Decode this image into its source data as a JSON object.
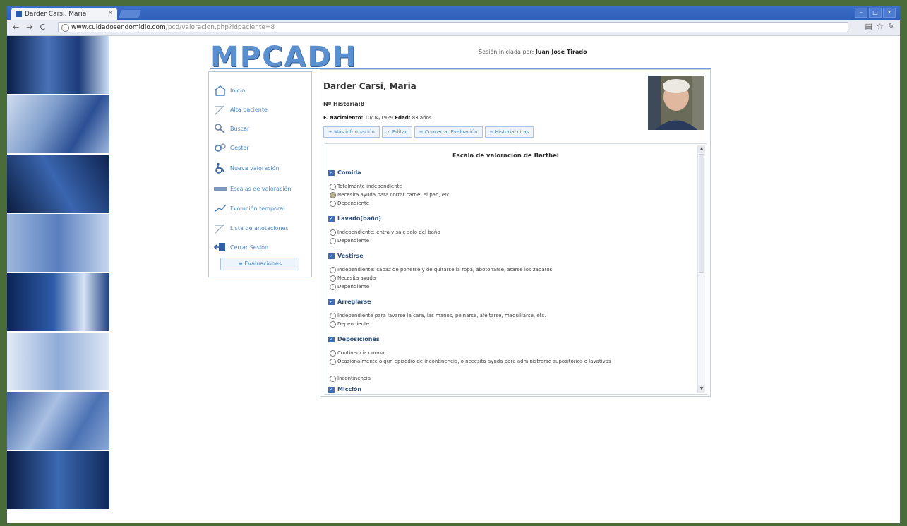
{
  "browser": {
    "tab_title": "Darder Carsi, Maria",
    "url_host": "www.cuidadosendomidio.com",
    "url_path": "/pcd/valoracion.php?idpaciente=8"
  },
  "site": {
    "logo": "MPCADH",
    "session_label": "Sesión iniciada por:",
    "session_user": "Juan José Tirado"
  },
  "menu": {
    "items": [
      {
        "label": "Inicio",
        "icon": "home-icon"
      },
      {
        "label": "Alta paciente",
        "icon": "pen-icon"
      },
      {
        "label": "Buscar",
        "icon": "magnifier-icon"
      },
      {
        "label": "Gestor",
        "icon": "gears-icon"
      },
      {
        "label": "Nueva valoración",
        "icon": "wheelchair-icon"
      },
      {
        "label": "Escalas de valoración",
        "icon": "scale-icon"
      },
      {
        "label": "Evolución temporal",
        "icon": "chart-icon"
      },
      {
        "label": "Lista de anotaciones",
        "icon": "pen-icon"
      },
      {
        "label": "Cerrar Sesión",
        "icon": "logout-icon"
      }
    ],
    "evaluations_button": "≡ Evaluaciones"
  },
  "patient": {
    "name": "Darder Carsi, Maria",
    "history": "Nº Historia:8",
    "birth_label": "F. Nacimiento:",
    "birth_value": "10/04/1929",
    "age_label": "Edad:",
    "age_value": "83 años",
    "buttons": [
      "+ Más información",
      "✓ Editar",
      "≡ Concertar Evaluación",
      "≡ Historial citas"
    ]
  },
  "scale": {
    "title": "Escala de valoración de Barthel",
    "categories": [
      {
        "name": "Comida",
        "options": [
          "Totalmente independiente",
          "Necesita ayuda para cortar carne, el pan, etc.",
          "Dependiente"
        ],
        "selected": 1
      },
      {
        "name": "Lavado(baño)",
        "options": [
          "Independiente: entra y sale solo del baño",
          "Dependiente"
        ]
      },
      {
        "name": "Vestirse",
        "options": [
          "Independiente: capaz de ponerse y de quitarse la ropa, abotonarse, atarse los zapatos",
          "Necesita ayuda",
          "Dependiente"
        ]
      },
      {
        "name": "Arreglarse",
        "options": [
          "Independiente para lavarse la cara, las manos, peinarse, afeitarse, maquillarse, etc.",
          "Dependiente"
        ]
      },
      {
        "name": "Deposiciones",
        "options": [
          "Continencia normal",
          "Ocasionalmente algún episodio de incontinencia, o necesita ayuda para administrarse supositorios o lavativas",
          "Incontinencia"
        ]
      },
      {
        "name": "Micción",
        "options": []
      }
    ]
  }
}
